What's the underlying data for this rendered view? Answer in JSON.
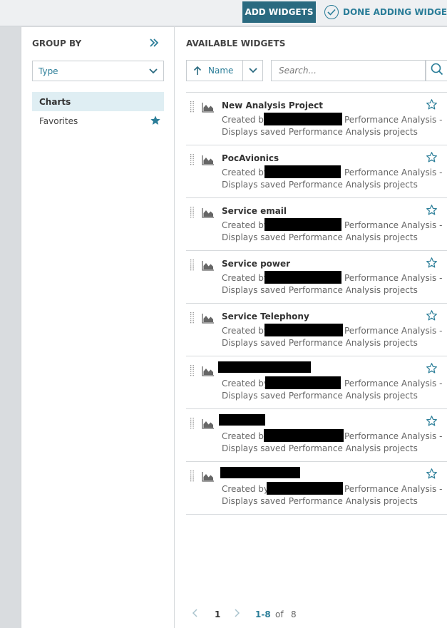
{
  "toolbar": {
    "add_widgets": "ADD WIDGETS",
    "done_adding": "DONE ADDING WIDGETS"
  },
  "group_by": {
    "title": "GROUP BY",
    "select_value": "Type",
    "items": [
      {
        "label": "Charts",
        "active": true
      },
      {
        "label": "Favorites",
        "icon": "star-filled-icon"
      }
    ]
  },
  "available": {
    "title": "AVAILABLE WIDGETS",
    "sort_label": "Name",
    "search_placeholder": "Search...",
    "widgets": [
      {
        "name": "New Analysis Project",
        "created_prefix": "Created by",
        "created_suffix": "Performance Analysis -",
        "description": "Displays saved Performance Analysis projects",
        "name_redacted": false
      },
      {
        "name": "PocAvionics",
        "created_prefix": "Created by",
        "created_suffix": "Performance Analysis -",
        "description": "Displays saved Performance Analysis projects",
        "name_redacted": false
      },
      {
        "name": "Service email",
        "created_prefix": "Created by",
        "created_suffix": "Performance Analysis -",
        "description": "Displays saved Performance Analysis projects",
        "name_redacted": false
      },
      {
        "name": "Service power",
        "created_prefix": "Created by",
        "created_suffix": "Performance Analysis -",
        "description": "Displays saved Performance Analysis projects",
        "name_redacted": false
      },
      {
        "name": "Service Telephony",
        "created_prefix": "Created by",
        "created_suffix": "Performance Analysis -",
        "description": "Displays saved Performance Analysis projects",
        "name_redacted": false
      },
      {
        "name": "",
        "created_prefix": "Created by",
        "created_suffix": "Performance Analysis -",
        "description": "Displays saved Performance Analysis projects",
        "name_redacted": true
      },
      {
        "name": "",
        "created_prefix": "Created by",
        "created_suffix": "Performance Analysis -",
        "description": "Displays saved Performance Analysis projects",
        "name_redacted": true
      },
      {
        "name": "",
        "created_prefix": "Created by",
        "created_suffix": "Performance Analysis -",
        "description": "Displays saved Performance Analysis projects",
        "name_redacted": true
      }
    ]
  },
  "pager": {
    "page": "1",
    "range": "1-8",
    "of": "of",
    "total": "8"
  },
  "colors": {
    "accent": "#2a7d98",
    "primary_button": "#2a6a80",
    "active_group_bg": "#dfeef3"
  }
}
